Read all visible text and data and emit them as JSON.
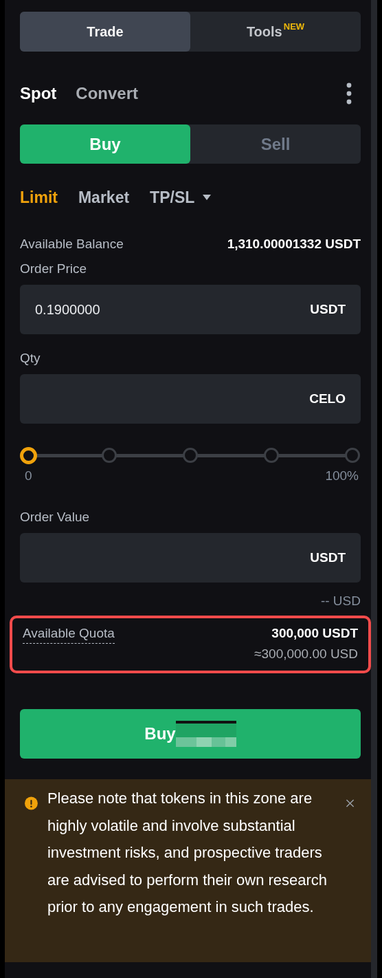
{
  "tabs": [
    {
      "label": "Trade",
      "selected": true
    },
    {
      "label": "Tools",
      "badge": "NEW",
      "selected": false
    }
  ],
  "modes": [
    {
      "label": "Spot",
      "selected": true
    },
    {
      "label": "Convert",
      "selected": false
    }
  ],
  "sides": [
    {
      "label": "Buy",
      "selected": true
    },
    {
      "label": "Sell",
      "selected": false
    }
  ],
  "order_types": [
    {
      "label": "Limit",
      "kind": "plain",
      "selected": true
    },
    {
      "label": "Market",
      "kind": "plain",
      "selected": false
    },
    {
      "label": "TP/SL",
      "kind": "dropdown",
      "selected": false
    }
  ],
  "balance": {
    "label": "Available Balance",
    "value": "1,310.00001332 USDT"
  },
  "fields": [
    {
      "label": "Order Price",
      "value": "0.1900000",
      "unit": "USDT"
    },
    {
      "label": "Qty",
      "unit": "CELO"
    }
  ],
  "slider": {
    "level": 0,
    "min_label": "0",
    "max_label": "100%"
  },
  "order_value": {
    "label": "Order Value",
    "unit": "USDT",
    "hint": "-- USD"
  },
  "quota": {
    "label": "Available Quota",
    "value": "300,000 USDT",
    "approx": "≈300,000.00 USD",
    "highlighted": true
  },
  "submit": {
    "label": "Buy",
    "redacted": true
  },
  "notice": {
    "text": "Please note that tokens in this zone are highly volatile and involve substantial investment risks, and prospective traders are advised to perform their own research prior to any engagement in such trades."
  }
}
